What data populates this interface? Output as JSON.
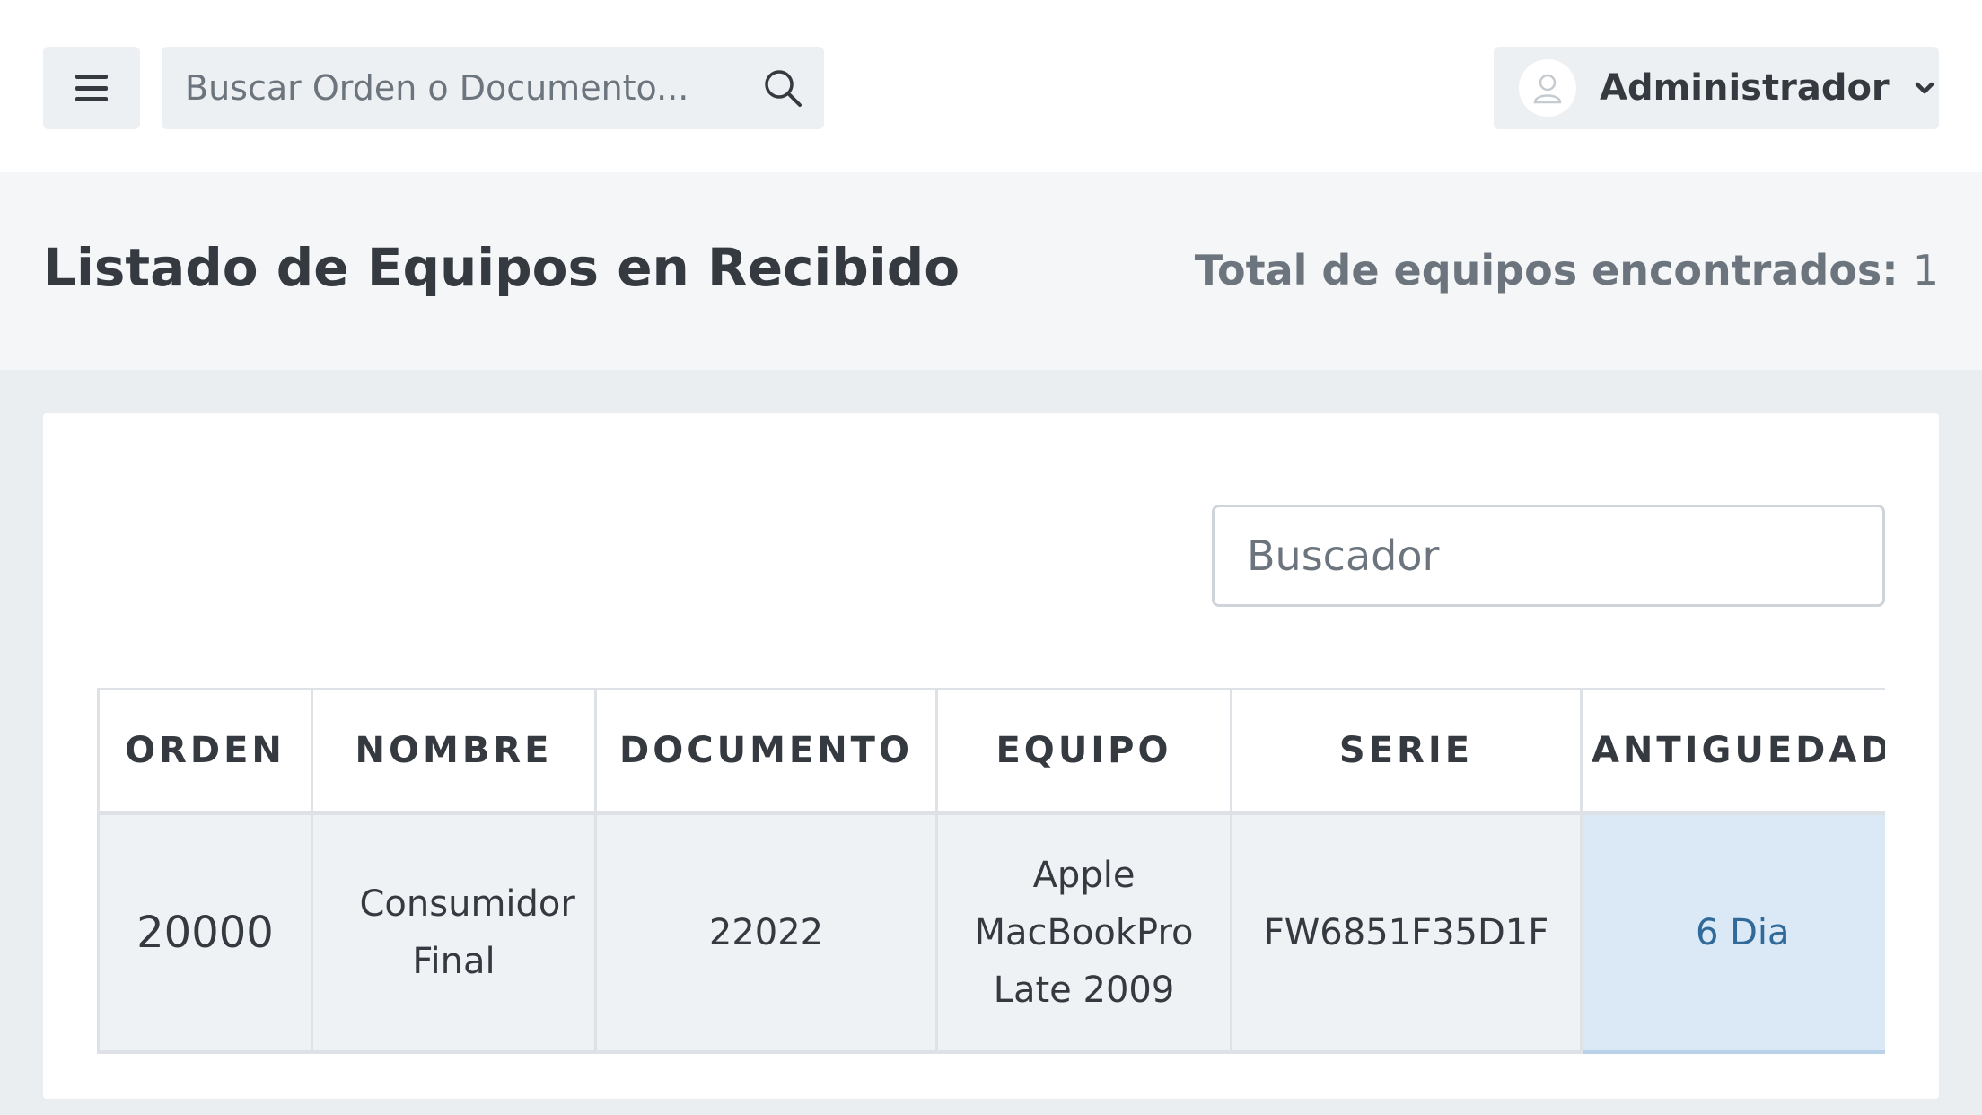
{
  "topbar": {
    "search_placeholder": "Buscar Orden o Documento...",
    "user_name": "Administrador"
  },
  "header": {
    "title": "Listado de Equipos en Recibido",
    "total_label": "Total de equipos encontrados:",
    "total_value": "1"
  },
  "card": {
    "search_placeholder": "Buscador",
    "table": {
      "columns": [
        "ORDEN",
        "NOMBRE",
        "DOCUMENTO",
        "EQUIPO",
        "SERIE",
        "ANTIGUEDAD"
      ],
      "rows": [
        {
          "orden": "20000",
          "nombre": "Consumidor Final",
          "documento": "22022",
          "equipo": "Apple MacBookPro Late 2009",
          "serie": "FW6851F35D1F",
          "antiguedad": "6 Dia"
        }
      ]
    }
  },
  "colors": {
    "accent_cell_bg": "#dbe9f6",
    "accent_cell_text": "#2f6a9a",
    "header_bg": "#f5f6f8",
    "page_bg": "#ebeef1"
  },
  "icons": [
    "hamburger-icon",
    "search-icon",
    "user-avatar-icon",
    "chevron-down-icon"
  ]
}
